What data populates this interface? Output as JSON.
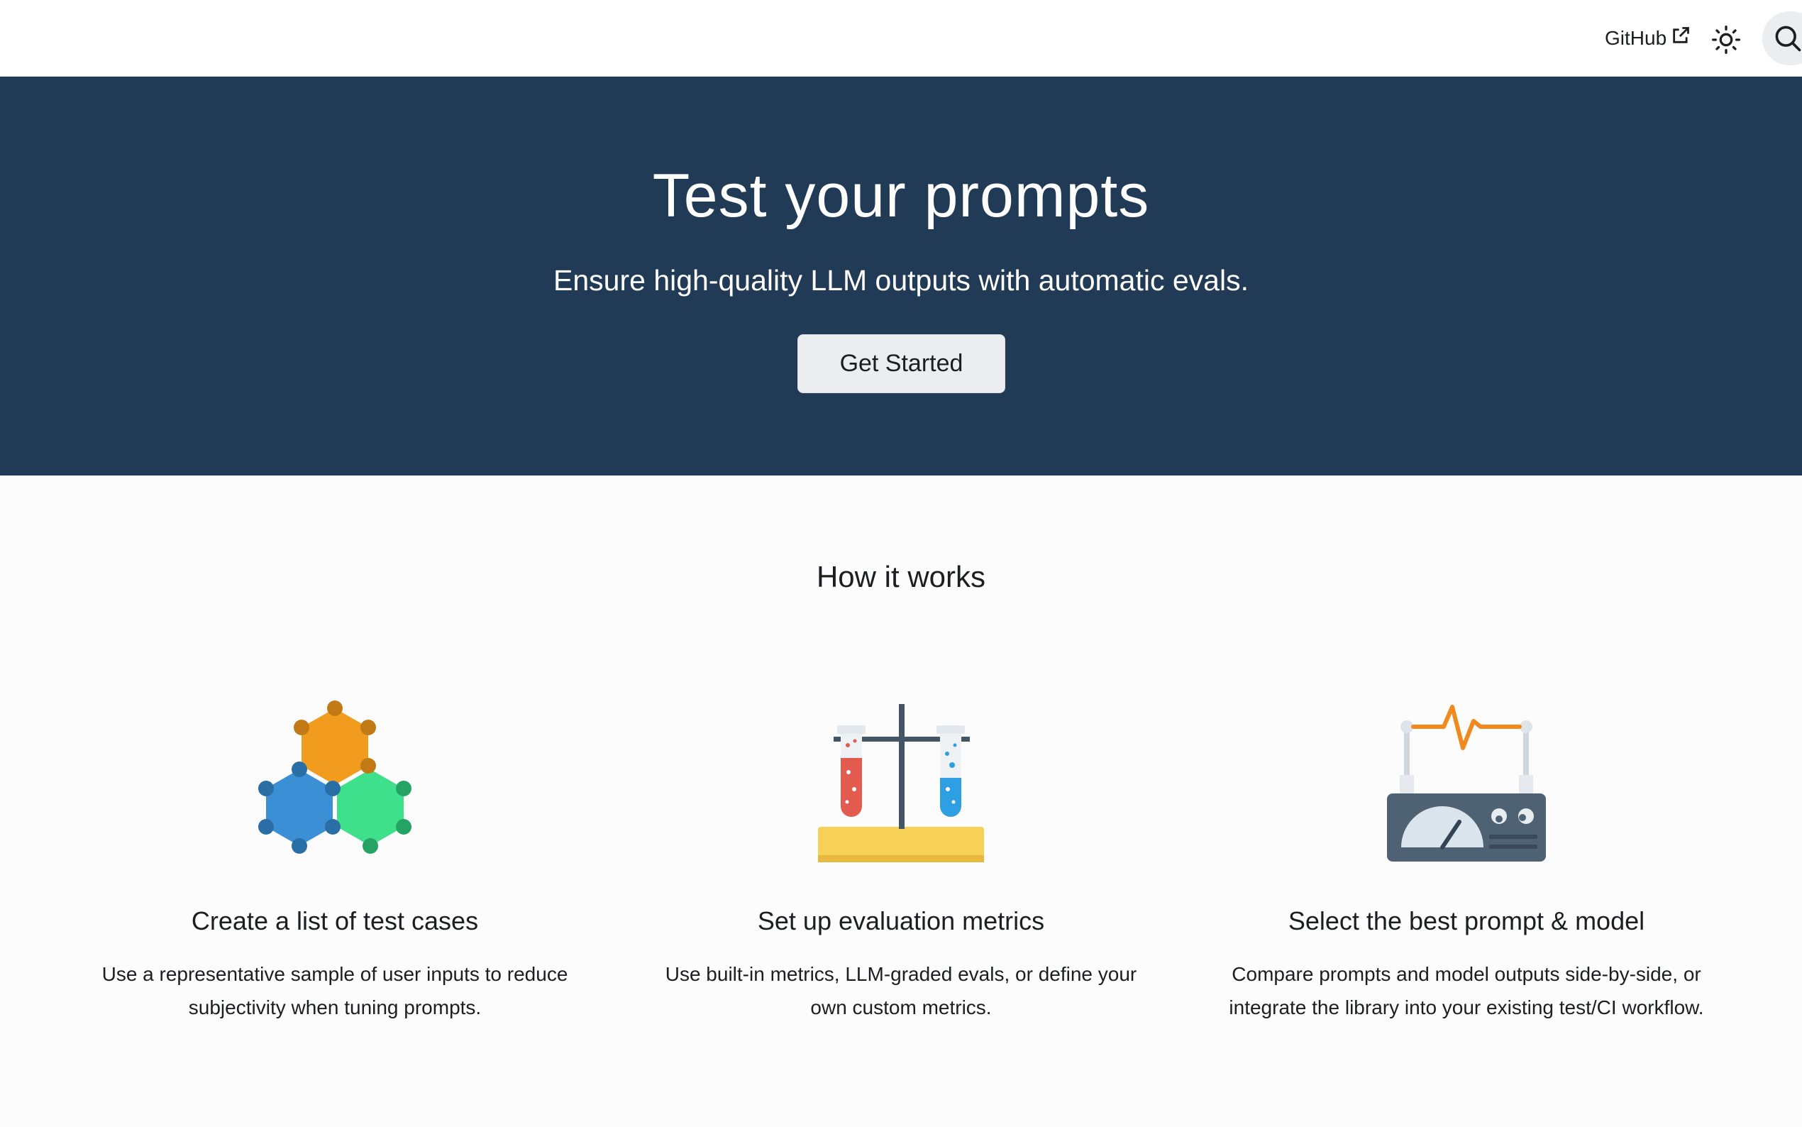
{
  "navbar": {
    "github_label": "GitHub",
    "github_icon": "external-link-icon",
    "theme_icon": "sun-icon",
    "search_icon": "search-icon"
  },
  "hero": {
    "title": "Test your prompts",
    "subtitle": "Ensure high-quality LLM outputs with automatic evals.",
    "cta_label": "Get Started",
    "background_color": "#213a55"
  },
  "how_it_works": {
    "title": "How it works",
    "features": [
      {
        "icon": "molecule-icon",
        "title": "Create a list of test cases",
        "description": "Use a representative sample of user inputs to reduce subjectivity when tuning prompts."
      },
      {
        "icon": "test-tubes-icon",
        "title": "Set up evaluation metrics",
        "description": "Use built-in metrics, LLM-graded evals, or define your own custom metrics."
      },
      {
        "icon": "monitor-gauge-icon",
        "title": "Select the best prompt & model",
        "description": "Compare prompts and model outputs side-by-side, or integrate the library into your existing test/CI workflow."
      }
    ]
  }
}
